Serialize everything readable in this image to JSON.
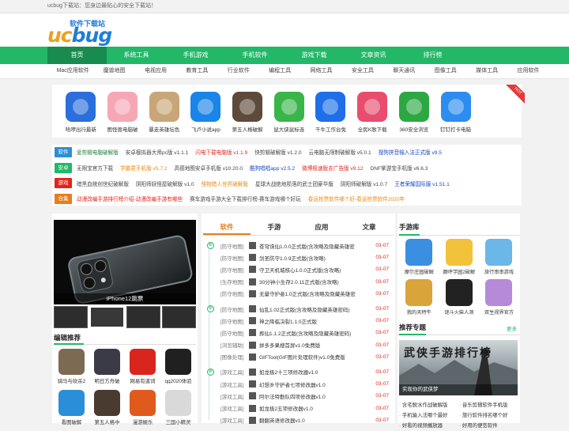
{
  "topbar": {
    "text": "ucbug下载站：您身边最贴心的安全下载站！"
  },
  "logo": {
    "u": "uc",
    "b": "bug",
    "slogan": "软件下载站"
  },
  "nav": [
    "首页",
    "系统工具",
    "手机游戏",
    "手机软件",
    "游戏下载",
    "文章资讯",
    "排行榜"
  ],
  "subnav": [
    "Mac应用软件",
    "魔兽地图",
    "电视应用",
    "教育工具",
    "行业软件",
    "编程工具",
    "网络工具",
    "安全工具",
    "聊天通讯",
    "图像工具",
    "媒体工具",
    "应用软件"
  ],
  "apps": [
    {
      "name": "哈啰出行最新",
      "color": "#2a6fdb"
    },
    {
      "name": "图怪兽电脑破",
      "color": "#f6a7b5"
    },
    {
      "name": "暴走英雄坛色",
      "color": "#c9a678"
    },
    {
      "name": "飞卢小说app",
      "color": "#1a85e8"
    },
    {
      "name": "第五人格破解",
      "color": "#5d4a3a"
    },
    {
      "name": "鼠大侠鼠标连",
      "color": "#39b54a"
    },
    {
      "name": "千牛工作台免",
      "color": "#1e6fe8"
    },
    {
      "name": "全民K歌下载",
      "color": "#e94d6d"
    },
    {
      "name": "360安全浏览",
      "color": "#2ca842"
    },
    {
      "name": "钉钉打卡电脑",
      "color": "#2d8cf0"
    }
  ],
  "hot_badge": "HOT",
  "tag_rows": [
    {
      "tag": "软件",
      "color": "#2a8fd8",
      "items": [
        {
          "t": "爱剪辑电脑破解版",
          "c": "green"
        },
        {
          "t": "安卓模拟器大师pc版 v1.1.1",
          "c": "dark"
        },
        {
          "t": "闪电下载电脑版 v1.1.9",
          "c": "red"
        },
        {
          "t": "快剪辑破解版 v1.2.0",
          "c": "dark"
        },
        {
          "t": "云电脑无限制破解版 v5.0.1",
          "c": "dark"
        },
        {
          "t": "搜狗拼音输入法正式版 v9.5",
          "c": "blue"
        }
      ]
    },
    {
      "tag": "安卓",
      "color": "#22b868",
      "items": [
        {
          "t": "无限宝官方下载",
          "c": "dark"
        },
        {
          "t": "学霸君手机版 v5.7.2",
          "c": "org"
        },
        {
          "t": "高德地图安卓手机版 v10.20.0",
          "c": "dark"
        },
        {
          "t": "酷狗唱唱app v2.5.2",
          "c": "blue"
        },
        {
          "t": "微博极速版去广告版 v9.12",
          "c": "red"
        },
        {
          "t": "DNF掌游宝手机版 v6.6.3",
          "c": "dark"
        }
      ]
    },
    {
      "tag": "游戏",
      "color": "#e3241b",
      "items": [
        {
          "t": "暗黑血统创世纪破解版",
          "c": "dark"
        },
        {
          "t": "阴阳师妖怪屋破解版 v1.0",
          "c": "dark"
        },
        {
          "t": "怪物猎人世界破解版",
          "c": "org"
        },
        {
          "t": "星球大战绝地陨落的武士团豪华版",
          "c": "dark"
        },
        {
          "t": "阴阳师破解版 v1.0.7",
          "c": "dark"
        },
        {
          "t": "王者荣耀国际服 v1.51.1",
          "c": "blue"
        }
      ]
    },
    {
      "tag": "合集",
      "color": "#e87d1e",
      "items": [
        {
          "t": "动漫改编手游排行榜介绍-动漫改编手游有哪些",
          "c": "red"
        },
        {
          "t": "赛车游戏手游大全下载排行榜-赛车游戏哪个好玩",
          "c": "dark"
        },
        {
          "t": "春运抢票软件哪个好-春运抢票软件2020年",
          "c": "org"
        }
      ]
    }
  ],
  "slide": {
    "caption": "iPhone12跳票"
  },
  "editor": {
    "title": "编辑推荐",
    "items": [
      {
        "name": "骑马与砍杀2",
        "color": "#7c6a52"
      },
      {
        "name": "明日方舟破",
        "color": "#3b3b48"
      },
      {
        "name": "网易有道词",
        "color": "#d8261f"
      },
      {
        "name": "qq2020体验",
        "color": "#202020"
      },
      {
        "name": "看图破解",
        "color": "#2a8fd8"
      },
      {
        "name": "第五人格中",
        "color": "#4a3b30"
      },
      {
        "name": "漫游娱乐",
        "color": "#e05a1c"
      },
      {
        "name": "三国小精灵",
        "color": "#d9d9d9"
      }
    ]
  },
  "tabs": [
    "软件",
    "手游",
    "应用",
    "文章"
  ],
  "list": [
    {
      "dot": "新",
      "cat": "[防守地图]",
      "title": "苍穹诛仙1.0.0正式版(含攻略及隐藏英雄密",
      "date": "03-07"
    },
    {
      "dot": "",
      "cat": "[防守地图]",
      "title": "剑圣防守1.0.9正式版(含攻略)",
      "date": "03-07"
    },
    {
      "dot": "",
      "cat": "[防守地图]",
      "title": "守卫天机城核心1.0.0正式版(含攻略)",
      "date": "03-07"
    },
    {
      "dot": "",
      "cat": "[生存地图]",
      "title": "30分钟小生存2.0.11正式版(含攻略)",
      "date": "03-07"
    },
    {
      "dot": "",
      "cat": "[防守地图]",
      "title": "无量守护者1.0正式版(含攻略及隐藏英雄密",
      "date": "03-07"
    },
    {
      "dot": "新",
      "cat": "[防守地图]",
      "title": "仙乱1.02正式版(含攻略及隐藏英雄密码)",
      "date": "03-07"
    },
    {
      "dot": "",
      "cat": "[防守地图]",
      "title": "神之降临决裂1.1.0正式版",
      "date": "03-07"
    },
    {
      "dot": "",
      "cat": "[防守地图]",
      "title": "葬仙1.1.2正式版(含攻略及隐藏英雄密码)",
      "date": "03-07"
    },
    {
      "dot": "",
      "cat": "[浏览辅助]",
      "title": "拼多多果搜首屏v1.0免费版",
      "date": "03-07"
    },
    {
      "dot": "",
      "cat": "[图像处理]",
      "title": "GIFTool(GIF图片处理软件)v1.0免费版",
      "date": "03-07"
    },
    {
      "dot": "新",
      "cat": "[游戏工具]",
      "title": "如龙极2十三项修改器v1.0",
      "date": "03-07"
    },
    {
      "dot": "",
      "cat": "[游戏工具]",
      "title": "幻想乡守护者七项修改器v1.0",
      "date": "03-07"
    },
    {
      "dot": "",
      "cat": "[游戏工具]",
      "title": "阿尔法特勤队四项修改器v1.0",
      "date": "03-07"
    },
    {
      "dot": "",
      "cat": "[游戏工具]",
      "title": "如龙极2五项修改器v1.0",
      "date": "03-07"
    },
    {
      "dot": "",
      "cat": "[游戏工具]",
      "title": "翻翻英语修改器v1.0",
      "date": "03-07"
    }
  ],
  "gamelib": {
    "title": "手游库",
    "items": [
      {
        "name": "摩尔庄园破解",
        "color": "#3a8fe0"
      },
      {
        "name": "巅坪学园2破解",
        "color": "#f2c23a"
      },
      {
        "name": "旅行串串游戏",
        "color": "#6ab7e8"
      },
      {
        "name": "我的天特牛",
        "color": "#d9a43a"
      },
      {
        "name": "谜斗火柴人测",
        "color": "#222222"
      },
      {
        "name": "双生视界官方",
        "color": "#b68ad8"
      }
    ]
  },
  "topics": {
    "title": "推荐专题",
    "more": "更多",
    "banner_caption": "实现你的武侠梦",
    "banner_text": "武侠手游排行榜",
    "links": [
      [
        "含宅鲵水作战破解版",
        "音乐剪辑软件手机版"
      ],
      [
        "手机输入法哪个最好",
        "旅行软件排名哪个好"
      ],
      [
        "好看的视频播放器",
        "好用的便签软件"
      ]
    ]
  }
}
